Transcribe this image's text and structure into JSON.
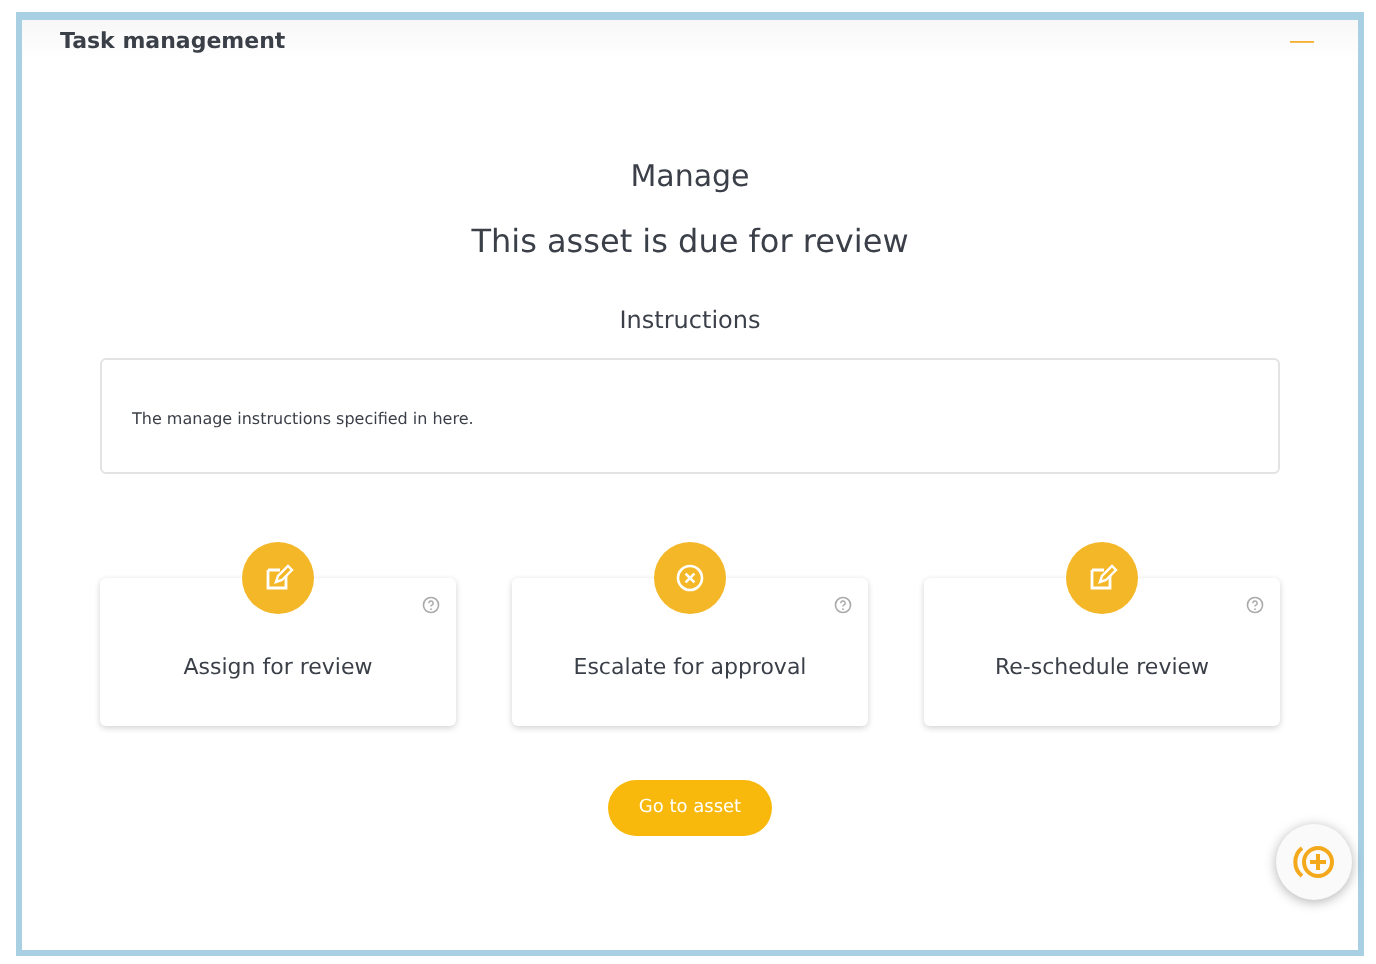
{
  "panel": {
    "title": "Task management",
    "collapse_icon": "—"
  },
  "heading": "Manage",
  "subheading": "This asset is due for review",
  "instructions": {
    "label": "Instructions",
    "text": "The manage instructions specified in here."
  },
  "actions": [
    {
      "kind": "edit",
      "label": "Assign for review"
    },
    {
      "kind": "cancel",
      "label": "Escalate for approval"
    },
    {
      "kind": "edit",
      "label": "Re-schedule review"
    }
  ],
  "primary_button": "Go to asset"
}
